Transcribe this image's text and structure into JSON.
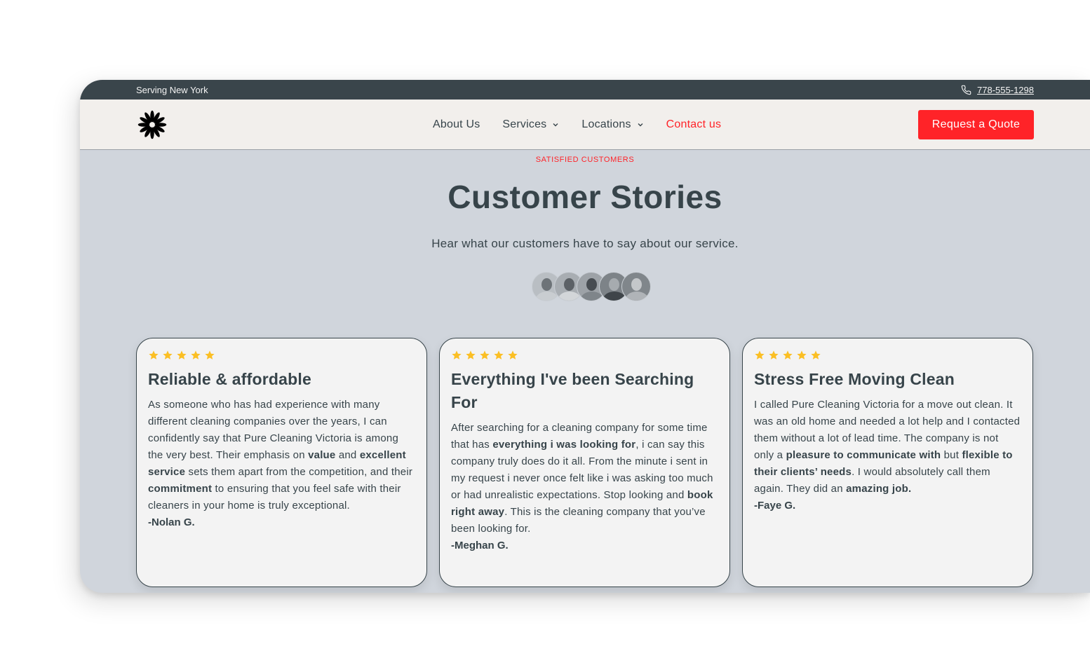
{
  "topbar": {
    "location": "Serving New York",
    "phone": "778-555-1298",
    "phone_icon": "phone-icon"
  },
  "navbar": {
    "logo_icon": "flower-logo-icon",
    "links": [
      {
        "label": "About Us",
        "has_dropdown": false
      },
      {
        "label": "Services",
        "has_dropdown": true
      },
      {
        "label": "Locations",
        "has_dropdown": true
      },
      {
        "label": "Contact us",
        "has_dropdown": false,
        "active": true
      }
    ],
    "cta": "Request a Quote"
  },
  "colors": {
    "accent": "#ff2328",
    "dark": "#37444a",
    "topbar_bg": "#3a454b",
    "nav_bg": "#f2efec",
    "section_bg": "#d0d5dc",
    "card_bg": "#f3f3f3",
    "star": "#fbbf24"
  },
  "section": {
    "eyebrow": "SATISFIED CUSTOMERS",
    "title": "Customer Stories",
    "subtitle": "Hear what our customers have to say about our service.",
    "avatar_count": 5
  },
  "testimonials": [
    {
      "rating": 5,
      "title": "Reliable & affordable",
      "segments": [
        {
          "t": "As someone who has had experience with many different cleaning companies over the years, I can confidently say that Pure Cleaning Victoria is among the very best. Their emphasis on ",
          "b": false
        },
        {
          "t": "value",
          "b": true
        },
        {
          "t": " and ",
          "b": false
        },
        {
          "t": "excellent service",
          "b": true
        },
        {
          "t": " sets them apart from the competition, and their ",
          "b": false
        },
        {
          "t": "commitment",
          "b": true
        },
        {
          "t": " to ensuring that you feel safe with their cleaners in your home is truly exceptional.",
          "b": false
        }
      ],
      "author": "-Nolan G."
    },
    {
      "rating": 5,
      "title": "Everything I've been Searching For",
      "segments": [
        {
          "t": "After searching for a cleaning company for some time that has ",
          "b": false
        },
        {
          "t": "everything i was looking for",
          "b": true
        },
        {
          "t": ", i can say this company truly does do it all. From the minute i sent in my request i never once felt like i was asking too much or had unrealistic expectations. Stop looking and ",
          "b": false
        },
        {
          "t": "book right away",
          "b": true
        },
        {
          "t": ". This is the cleaning company that you’ve been looking for.",
          "b": false
        }
      ],
      "author": "-Meghan G."
    },
    {
      "rating": 5,
      "title": "Stress Free Moving Clean",
      "segments": [
        {
          "t": "I called Pure Cleaning Victoria for a move out clean.  It was an old home and needed a lot help and I contacted them without a lot of lead time.  The company is not only a ",
          "b": false
        },
        {
          "t": "pleasure to communicate with",
          "b": true
        },
        {
          "t": " but ",
          "b": false
        },
        {
          "t": "flexible to their clients’ needs",
          "b": true
        },
        {
          "t": ".  I would absolutely call them again.  They did an ",
          "b": false
        },
        {
          "t": "amazing job.",
          "b": true
        }
      ],
      "author": "-Faye G."
    }
  ]
}
